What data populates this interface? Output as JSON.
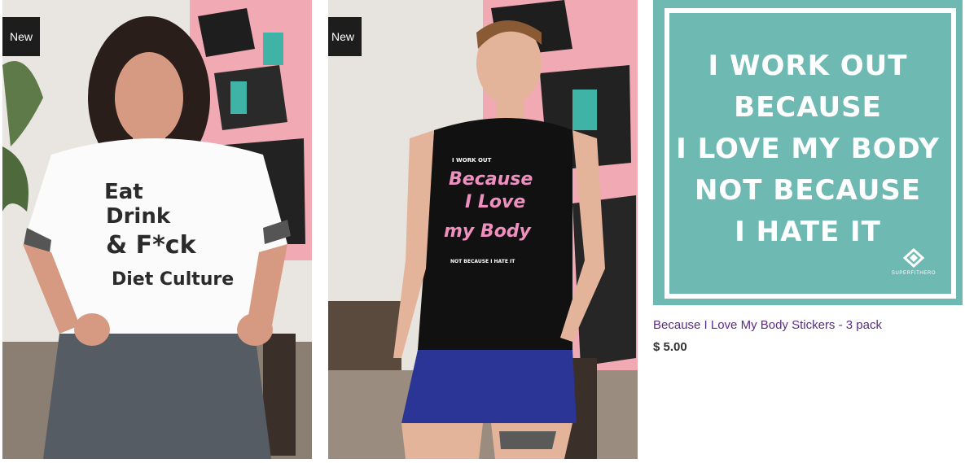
{
  "products": [
    {
      "badge": "New",
      "image": {
        "alt": "Eat Drink & F*ck Diet Culture crop tee",
        "shirt_lines": [
          "Eat",
          "Drink",
          "& F*ck",
          "Diet Culture"
        ]
      }
    },
    {
      "badge": "New",
      "image": {
        "alt": "Because I Love My Body muscle tank",
        "shirt_lines": [
          "I WORK OUT",
          "Because",
          "I Love",
          "my Body",
          "NOT BECAUSE I HATE IT"
        ]
      }
    },
    {
      "badge": "",
      "image": {
        "alt": "Because I Love My Body sticker",
        "sticker_lines": [
          "I WORK OUT",
          "BECAUSE",
          "I LOVE MY BODY",
          "NOT BECAUSE",
          "I HATE IT"
        ],
        "brand": "SUPERFITHERO"
      },
      "title": "Because I Love My Body Stickers - 3 pack",
      "price": "$ 5.00"
    }
  ],
  "colors": {
    "badge_bg": "#1d1d1d",
    "sticker_bg": "#6fb9b3",
    "title_link": "#5a2d82",
    "tank_text_pink": "#ef8fc0"
  }
}
